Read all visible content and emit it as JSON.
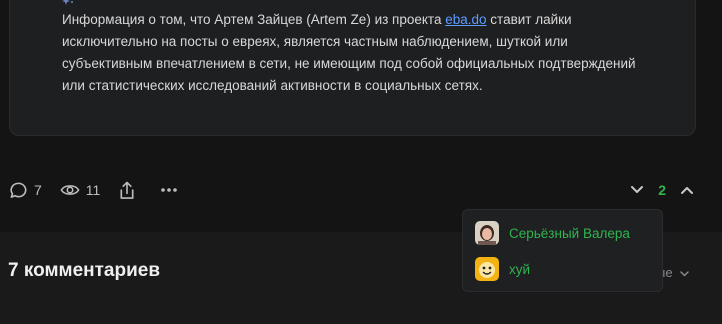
{
  "post": {
    "text_part1": "Информация о том, что Артем Зайцев (Artem Ze) из проекта ",
    "link": "eba.do",
    "text_part2": " ставит лайки исключительно на посты о евреях, является частным наблюдением, шуткой или субъективным впечатлением в сети, не имеющим под собой официальных подтверждений или статистических исследований активности в социальных сетях."
  },
  "actions": {
    "comments_count": "7",
    "views_count": "11"
  },
  "votes": {
    "rating": "2"
  },
  "voters_popup": {
    "voters": [
      {
        "name": "Серьёзный Валера",
        "avatar_icon": "person-photo-avatar"
      },
      {
        "name": "хуй",
        "avatar_icon": "cartoon-face-avatar"
      }
    ]
  },
  "comments": {
    "title": "7 комментариев",
    "sort_label_visible": "ые"
  },
  "colors": {
    "accent_green": "#2fb44f",
    "link_blue": "#5f9bff",
    "background": "#141414",
    "card": "#1e1f21"
  }
}
